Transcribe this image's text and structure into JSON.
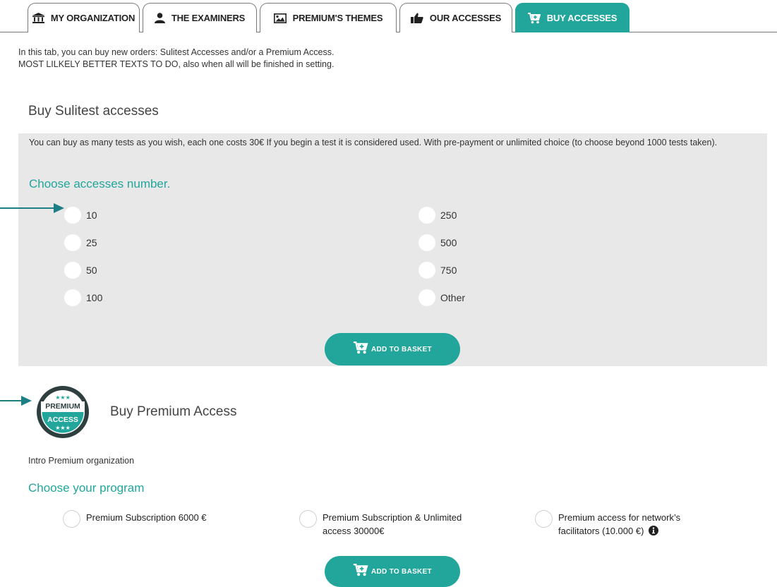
{
  "tabs": [
    {
      "label": "MY ORGANIZATION",
      "icon": "bank-icon"
    },
    {
      "label": "THE EXAMINERS",
      "icon": "user-icon"
    },
    {
      "label": "PREMIUM'S THEMES",
      "icon": "image-icon"
    },
    {
      "label": "OUR ACCESSES",
      "icon": "thumbs-up-icon"
    },
    {
      "label": "BUY ACCESSES",
      "icon": "cart-plus-icon",
      "active": true
    }
  ],
  "intro": {
    "line1": "In this tab, you can buy new orders: Sulitest Accesses and/or a Premium Access.",
    "line2": "MOST LILKELY BETTER TEXTS TO DO, also when all will be finished in setting."
  },
  "sulitest": {
    "title": "Buy Sulitest accesses",
    "description": "You can buy as many tests as you wish, each one costs 30€ If you begin a test it is considered used. With pre-payment or unlimited choice (to choose beyond 1000 tests taken).",
    "choose_label": "Choose accesses number.",
    "options_left": [
      "10",
      "25",
      "50",
      "100"
    ],
    "options_right": [
      "250",
      "500",
      "750",
      "Other"
    ],
    "add_button": "ADD TO BASKET"
  },
  "premium": {
    "badge_top": "PREMIUM",
    "badge_bottom": "ACCESS",
    "title": "Buy Premium Access",
    "intro": "Intro Premium organization",
    "choose_label": "Choose your program",
    "programs": [
      {
        "line1": "Premium Subscription 6000 €",
        "line2": ""
      },
      {
        "line1": "Premium Subscription & Unlimited",
        "line2": "access 30000€"
      },
      {
        "line1": "Premium access for network’s",
        "line2": "facilitators (10.000 €)"
      }
    ],
    "add_button": "ADD TO BASKET"
  },
  "colors": {
    "accent": "#22a69b",
    "panel": "#e8e8e8",
    "arrow": "#1d7f86"
  }
}
